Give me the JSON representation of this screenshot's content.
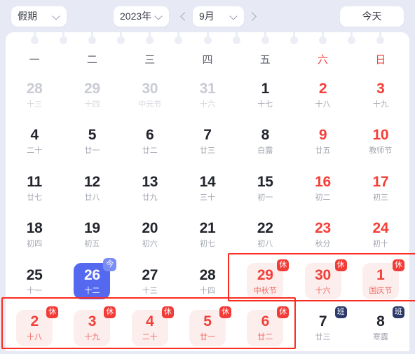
{
  "theme": {
    "page_bg": "#e7eaf4",
    "card_bg": "#ffffff",
    "accent_red": "#f5403a",
    "accent_blue": "#5468f0",
    "badge_work_blue": "#2b3a6b",
    "annotation_red": "#fb2b20"
  },
  "toolbar": {
    "holiday_select": {
      "label": "假期",
      "icon": "chevron-down-icon"
    },
    "year_select": {
      "label": "2023年",
      "icon": "chevron-down-icon"
    },
    "prev_month": {
      "icon": "chevron-left-icon"
    },
    "month_select": {
      "label": "9月",
      "icon": "chevron-down-icon"
    },
    "next_month": {
      "icon": "chevron-right-icon"
    },
    "today_button": {
      "label": "今天"
    }
  },
  "calendar": {
    "weekdays": [
      {
        "label": "一",
        "weekend": false
      },
      {
        "label": "二",
        "weekend": false
      },
      {
        "label": "三",
        "weekend": false
      },
      {
        "label": "四",
        "weekend": false
      },
      {
        "label": "五",
        "weekend": false
      },
      {
        "label": "六",
        "weekend": true
      },
      {
        "label": "日",
        "weekend": true
      }
    ],
    "rows": [
      [
        {
          "day": "28",
          "sub": "十三",
          "state": "out",
          "badge": ""
        },
        {
          "day": "29",
          "sub": "十四",
          "state": "out",
          "badge": ""
        },
        {
          "day": "30",
          "sub": "中元节",
          "state": "out",
          "badge": ""
        },
        {
          "day": "31",
          "sub": "十六",
          "state": "out",
          "badge": ""
        },
        {
          "day": "1",
          "sub": "十七",
          "state": "normal",
          "badge": ""
        },
        {
          "day": "2",
          "sub": "十八",
          "state": "red",
          "badge": ""
        },
        {
          "day": "3",
          "sub": "十九",
          "state": "red",
          "badge": ""
        }
      ],
      [
        {
          "day": "4",
          "sub": "二十",
          "state": "normal",
          "badge": ""
        },
        {
          "day": "5",
          "sub": "廿一",
          "state": "normal",
          "badge": ""
        },
        {
          "day": "6",
          "sub": "廿二",
          "state": "normal",
          "badge": ""
        },
        {
          "day": "7",
          "sub": "廿三",
          "state": "normal",
          "badge": ""
        },
        {
          "day": "8",
          "sub": "白露",
          "state": "normal",
          "badge": ""
        },
        {
          "day": "9",
          "sub": "廿五",
          "state": "red",
          "badge": ""
        },
        {
          "day": "10",
          "sub": "教师节",
          "state": "red",
          "badge": ""
        }
      ],
      [
        {
          "day": "11",
          "sub": "廿七",
          "state": "normal",
          "badge": ""
        },
        {
          "day": "12",
          "sub": "廿八",
          "state": "normal",
          "badge": ""
        },
        {
          "day": "13",
          "sub": "廿九",
          "state": "normal",
          "badge": ""
        },
        {
          "day": "14",
          "sub": "三十",
          "state": "normal",
          "badge": ""
        },
        {
          "day": "15",
          "sub": "初一",
          "state": "normal",
          "badge": ""
        },
        {
          "day": "16",
          "sub": "初二",
          "state": "red",
          "badge": ""
        },
        {
          "day": "17",
          "sub": "初三",
          "state": "red",
          "badge": ""
        }
      ],
      [
        {
          "day": "18",
          "sub": "初四",
          "state": "normal",
          "badge": ""
        },
        {
          "day": "19",
          "sub": "初五",
          "state": "normal",
          "badge": ""
        },
        {
          "day": "20",
          "sub": "初六",
          "state": "normal",
          "badge": ""
        },
        {
          "day": "21",
          "sub": "初七",
          "state": "normal",
          "badge": ""
        },
        {
          "day": "22",
          "sub": "初八",
          "state": "normal",
          "badge": ""
        },
        {
          "day": "23",
          "sub": "秋分",
          "state": "red",
          "badge": ""
        },
        {
          "day": "24",
          "sub": "初十",
          "state": "red",
          "badge": ""
        }
      ],
      [
        {
          "day": "25",
          "sub": "十一",
          "state": "normal",
          "badge": ""
        },
        {
          "day": "26",
          "sub": "十二",
          "state": "today",
          "badge": "今"
        },
        {
          "day": "27",
          "sub": "十三",
          "state": "normal",
          "badge": ""
        },
        {
          "day": "28",
          "sub": "十四",
          "state": "normal",
          "badge": ""
        },
        {
          "day": "29",
          "sub": "中秋节",
          "state": "rest",
          "badge": "休"
        },
        {
          "day": "30",
          "sub": "十六",
          "state": "rest",
          "badge": "休"
        },
        {
          "day": "1",
          "sub": "国庆节",
          "state": "rest",
          "badge": "休"
        }
      ],
      [
        {
          "day": "2",
          "sub": "十八",
          "state": "rest",
          "badge": "休"
        },
        {
          "day": "3",
          "sub": "十九",
          "state": "rest",
          "badge": "休"
        },
        {
          "day": "4",
          "sub": "二十",
          "state": "rest",
          "badge": "休"
        },
        {
          "day": "5",
          "sub": "廿一",
          "state": "rest",
          "badge": "休"
        },
        {
          "day": "6",
          "sub": "廿二",
          "state": "rest",
          "badge": "休"
        },
        {
          "day": "7",
          "sub": "廿三",
          "state": "normal",
          "badge": "班"
        },
        {
          "day": "8",
          "sub": "寒露",
          "state": "normal",
          "badge": "班"
        }
      ]
    ]
  },
  "annotations": [
    {
      "name": "annotation-box-midautumn-nationalday"
    },
    {
      "name": "annotation-box-nationalday-holiday"
    }
  ]
}
